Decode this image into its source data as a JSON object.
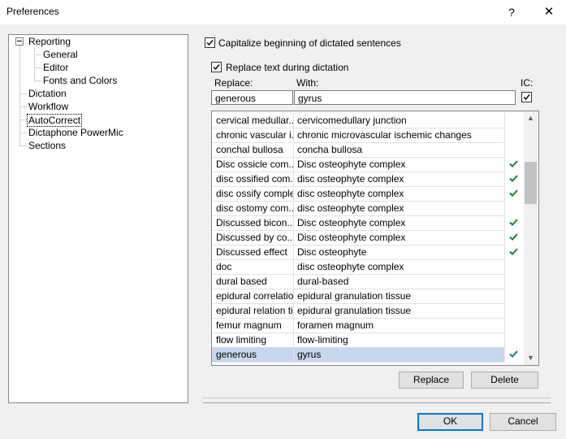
{
  "window": {
    "title": "Preferences",
    "help": "?",
    "close": "✕"
  },
  "tree": {
    "items": [
      {
        "label": "Reporting",
        "level": 0,
        "expanded": true
      },
      {
        "label": "General",
        "level": 1
      },
      {
        "label": "Editor",
        "level": 1
      },
      {
        "label": "Fonts and Colors",
        "level": 1
      },
      {
        "label": "Dictation",
        "level": 0
      },
      {
        "label": "Workflow",
        "level": 0
      },
      {
        "label": "AutoCorrect",
        "level": 0,
        "selected": true
      },
      {
        "label": "Dictaphone PowerMic",
        "level": 0
      },
      {
        "label": "Sections",
        "level": 0
      }
    ]
  },
  "options": {
    "capitalize": {
      "label": "Capitalize beginning of dictated sentences",
      "checked": true
    },
    "replace_text": {
      "label": "Replace text during dictation",
      "checked": true
    }
  },
  "editor": {
    "replace_header": "Replace:",
    "with_header": "With:",
    "ic_header": "IC:",
    "replace_value": "generous",
    "with_value": "gyrus",
    "ic_checked": true
  },
  "table": {
    "rows": [
      {
        "replace": "cervical medullar...",
        "with": "cervicomedullary junction",
        "ic": false
      },
      {
        "replace": "chronic vascular i...",
        "with": "chronic microvascular ischemic changes",
        "ic": false
      },
      {
        "replace": "conchal bullosa",
        "with": "concha bullosa",
        "ic": false
      },
      {
        "replace": "Disc ossicle com...",
        "with": "Disc osteophyte complex",
        "ic": true
      },
      {
        "replace": "disc ossified com...",
        "with": "disc osteophyte complex",
        "ic": true
      },
      {
        "replace": "disc ossify complex",
        "with": "disc osteophyte complex",
        "ic": true
      },
      {
        "replace": "disc ostomy com...",
        "with": "disc osteophyte complex",
        "ic": false
      },
      {
        "replace": "Discussed bicon...",
        "with": "Disc osteophyte complex",
        "ic": true
      },
      {
        "replace": "Discussed by co...",
        "with": "Disc osteophyte complex",
        "ic": true
      },
      {
        "replace": "Discussed effect",
        "with": "Disc osteophyte",
        "ic": true
      },
      {
        "replace": "doc",
        "with": "disc osteophyte complex",
        "ic": false
      },
      {
        "replace": "dural based",
        "with": "dural-based",
        "ic": false
      },
      {
        "replace": "epidural correlatio...",
        "with": "epidural granulation tissue",
        "ic": false
      },
      {
        "replace": "epidural relation ti...",
        "with": "epidural granulation tissue",
        "ic": false
      },
      {
        "replace": "femur magnum",
        "with": "foramen magnum",
        "ic": false
      },
      {
        "replace": "flow limiting",
        "with": "flow-limiting",
        "ic": false
      },
      {
        "replace": "generous",
        "with": "gyrus",
        "ic": true,
        "selected": true
      }
    ]
  },
  "buttons": {
    "replace": "Replace",
    "delete": "Delete",
    "ok": "OK",
    "cancel": "Cancel"
  },
  "colors": {
    "check_green": "#1e7e34",
    "selection": "#c6d7ee",
    "focus": "#0078d7"
  }
}
